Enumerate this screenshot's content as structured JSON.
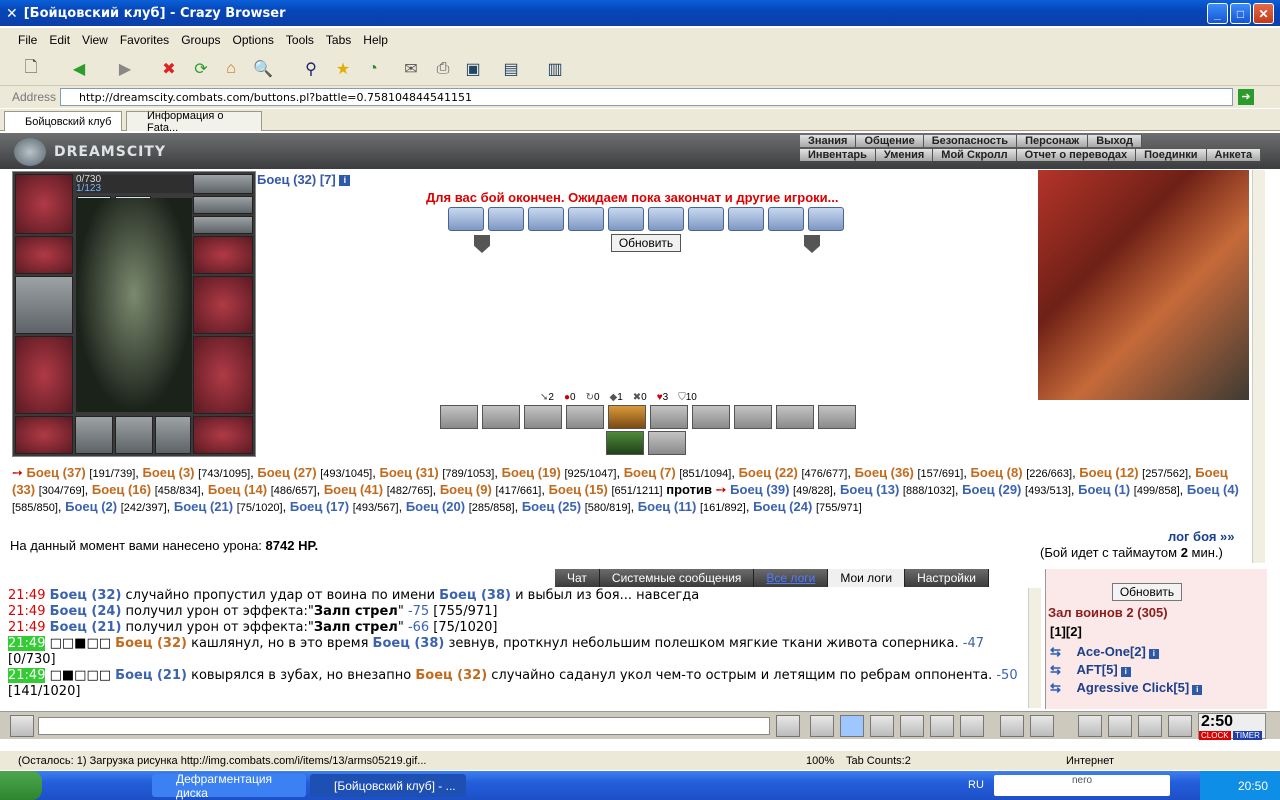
{
  "window": {
    "title": "[Бойцовский клуб] - Crazy Browser"
  },
  "menu": [
    "File",
    "Edit",
    "View",
    "Favorites",
    "Groups",
    "Options",
    "Tools",
    "Tabs",
    "Help"
  ],
  "address": {
    "label": "Address",
    "url": "http://dreamscity.combats.com/buttons.pl?battle=0.758104844541151"
  },
  "tabs": [
    "Бойцовский клуб",
    "Информация о Fata..."
  ],
  "game": {
    "logo": "DREAMSCITY",
    "nav_top": [
      "Знания",
      "Общение",
      "Безопасность",
      "Персонаж",
      "Выход"
    ],
    "nav_bottom": [
      "Инвентарь",
      "Умения",
      "Мой Скролл",
      "Отчет о переводах",
      "Поединки",
      "Анкета"
    ],
    "hp": "0/730",
    "mana": "1/123",
    "player": "Боец (32) [7]",
    "end_message": "Для вас бой окончен. Ожидаем пока закончат и другие игроки...",
    "refresh": "Обновить",
    "stats": [
      "2",
      "0",
      "0",
      "1",
      "0",
      "3",
      "10"
    ],
    "damage_label": "На данный момент вами нанесено урона:",
    "damage_value": "8742 HP.",
    "log_link": "лог боя »»",
    "timeout_pre": "(Бой идет с таймаутом ",
    "timeout_val": "2",
    "timeout_post": " мин.)"
  },
  "fighters": {
    "team1": [
      {
        "n": "Боец (37)",
        "h": "[191/739]"
      },
      {
        "n": "Боец (3)",
        "h": "[743/1095]"
      },
      {
        "n": "Боец (27)",
        "h": "[493/1045]"
      },
      {
        "n": "Боец (31)",
        "h": "[789/1053]"
      },
      {
        "n": "Боец (19)",
        "h": "[925/1047]"
      },
      {
        "n": "Боец (7)",
        "h": "[851/1094]"
      },
      {
        "n": "Боец (22)",
        "h": "[476/677]"
      },
      {
        "n": "Боец (36)",
        "h": "[157/691]"
      },
      {
        "n": "Боец (8)",
        "h": "[226/663]"
      },
      {
        "n": "Боец (12)",
        "h": "[257/562]"
      },
      {
        "n": "Боец (33)",
        "h": "[304/769]"
      },
      {
        "n": "Боец (16)",
        "h": "[458/834]"
      },
      {
        "n": "Боец (14)",
        "h": "[486/657]"
      },
      {
        "n": "Боец (41)",
        "h": "[482/765]"
      },
      {
        "n": "Боец (9)",
        "h": "[417/661]"
      },
      {
        "n": "Боец (15)",
        "h": "[651/1211]"
      }
    ],
    "vs": "против",
    "team2": [
      {
        "n": "Боец (39)",
        "h": "[49/828]"
      },
      {
        "n": "Боец (13)",
        "h": "[888/1032]"
      },
      {
        "n": "Боец (29)",
        "h": "[493/513]"
      },
      {
        "n": "Боец (1)",
        "h": "[499/858]"
      },
      {
        "n": "Боец (4)",
        "h": "[585/850]"
      },
      {
        "n": "Боец (2)",
        "h": "[242/397]"
      },
      {
        "n": "Боец (21)",
        "h": "[75/1020]"
      },
      {
        "n": "Боец (17)",
        "h": "[493/567]"
      },
      {
        "n": "Боец (20)",
        "h": "[285/858]"
      },
      {
        "n": "Боец (25)",
        "h": "[580/819]"
      },
      {
        "n": "Боец (11)",
        "h": "[161/892]"
      },
      {
        "n": "Боец (24)",
        "h": "[755/971]"
      }
    ]
  },
  "chat_tabs": [
    "Чат",
    "Системные сообщения",
    "Все логи",
    "Мои логи",
    "Настройки"
  ],
  "chat": [
    {
      "t": "21:49",
      "html": "<b class='dmg'>Боец (32)</b> случайно пропустил удар от воина по имени <b class='dmg'>Боец (38)</b> и выбыл из боя... навсегда"
    },
    {
      "t": "21:49",
      "html": "<b class='dmg'>Боец (24)</b> получил урон от эффекта:\"<b>Залп стрел</b>\" <span class='dmg'>-75</span> [755/971]"
    },
    {
      "t": "21:49",
      "html": "<b class='dmg'>Боец (21)</b> получил урон от эффекта:\"<b>Залп стрел</b>\" <span class='dmg'>-66</span> [75/1020]"
    },
    {
      "t": "21:49",
      "g": true,
      "html": "□□■□□ <b class='fo'>Боец (32)</b> кашлянул, но в это время <b class='dmg'>Боец (38)</b> зевнув, проткнул небольшим полешком мягкие ткани живота соперника. <span class='dmg'>-47</span> [0/730]"
    },
    {
      "t": "21:49",
      "g": true,
      "html": "□■□□□ <b class='dmg'>Боец (21)</b> ковырялся в зубах, но внезапно <b class='fo'>Боец (32)</b> случайно саданул укол чем-то острым и летящим по ребрам оппонента. <span class='dmg'>-50</span> [141/1020]"
    }
  ],
  "right": {
    "refresh": "Обновить",
    "room": "Зал воинов 2 (305)",
    "pages": "[1][2]",
    "users": [
      "Ace-One[2]",
      "AFT[5]",
      "Agressive Click[5]"
    ]
  },
  "clock": {
    "time": "2:50",
    "label1": "CLOCK",
    "label2": "TIMER"
  },
  "status": {
    "text": "(Осталось: 1) Загрузка рисунка http://img.combats.com/i/items/13/arms05219.gif...",
    "zoom": "100%",
    "tabs": "Tab Counts:2",
    "zone": "Интернет"
  },
  "taskbar": {
    "task1": "Дефрагментация диска",
    "task2": "[Бойцовский клуб] - ...",
    "lang": "RU",
    "time": "20:50",
    "search": "nero"
  }
}
